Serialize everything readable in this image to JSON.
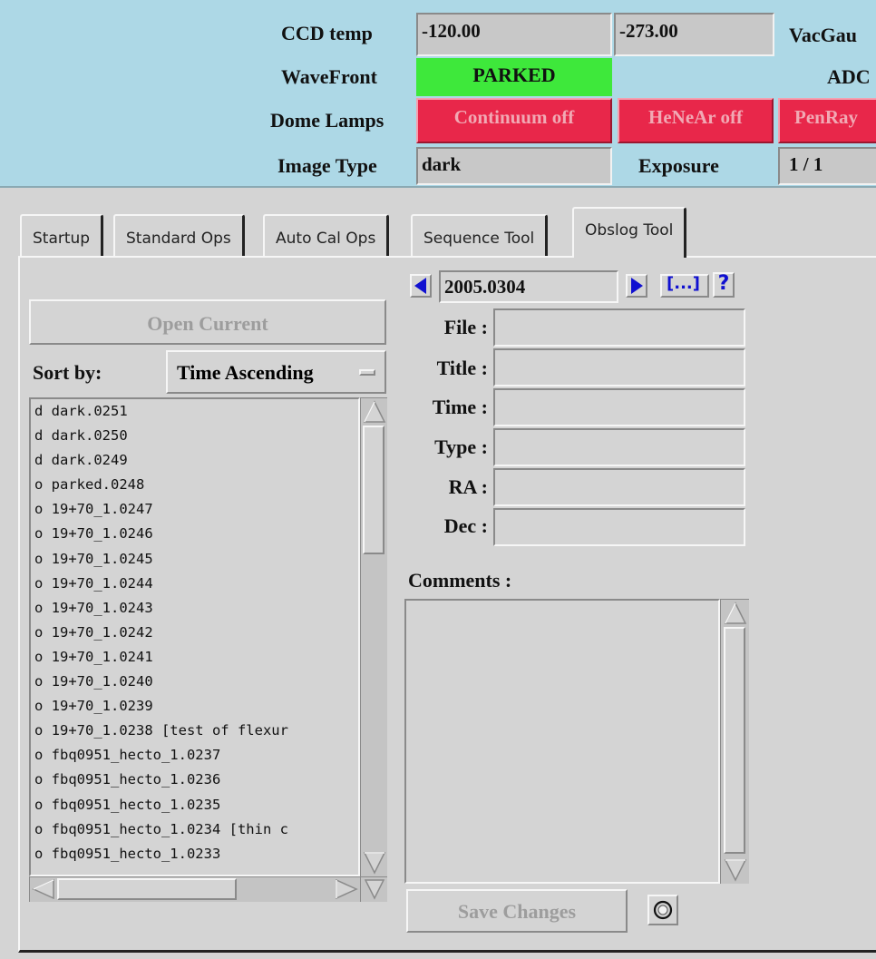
{
  "status": {
    "ccd_temp_label": "CCD temp",
    "ccd_temp_value": "-120.00",
    "ccd_temp_value2": "-273.00",
    "vacgauge_label": "VacGau",
    "wavefront_label": "WaveFront",
    "wavefront_value": "PARKED",
    "adc_label": "ADC",
    "dome_lamps_label": "Dome Lamps",
    "lamp_continuum": "Continuum off",
    "lamp_henear": "HeNeAr off",
    "lamp_penray": "PenRay",
    "image_type_label": "Image Type",
    "image_type_value": "dark",
    "exposure_label": "Exposure",
    "exposure_value": "1 / 1"
  },
  "tabs": [
    {
      "label": "Startup"
    },
    {
      "label": "Standard Ops"
    },
    {
      "label": "Auto Cal Ops"
    },
    {
      "label": "Sequence Tool"
    },
    {
      "label": "Obslog Tool"
    }
  ],
  "left": {
    "open_current_label": "Open Current",
    "sort_label": "Sort by:",
    "sort_value": "Time Ascending",
    "files": [
      "d dark.0251",
      "d dark.0250",
      "d dark.0249",
      "o parked.0248",
      "o 19+70_1.0247",
      "o 19+70_1.0246",
      "o 19+70_1.0245",
      "o 19+70_1.0244",
      "o 19+70_1.0243",
      "o 19+70_1.0242",
      "o 19+70_1.0241",
      "o 19+70_1.0240",
      "o 19+70_1.0239",
      "o 19+70_1.0238 [test of flexur",
      "o fbq0951_hecto_1.0237",
      "o fbq0951_hecto_1.0236",
      "o fbq0951_hecto_1.0235",
      "o fbq0951_hecto_1.0234 [thin c",
      "o fbq0951_hecto_1.0233"
    ]
  },
  "right": {
    "date_value": "2005.0304",
    "browse_label": "[...]",
    "help_label": "?",
    "file_label": "File :",
    "title_label": "Title :",
    "time_label": "Time :",
    "type_label": "Type :",
    "ra_label": "RA :",
    "dec_label": "Dec :",
    "comments_label": "Comments :",
    "save_label": "Save Changes"
  }
}
